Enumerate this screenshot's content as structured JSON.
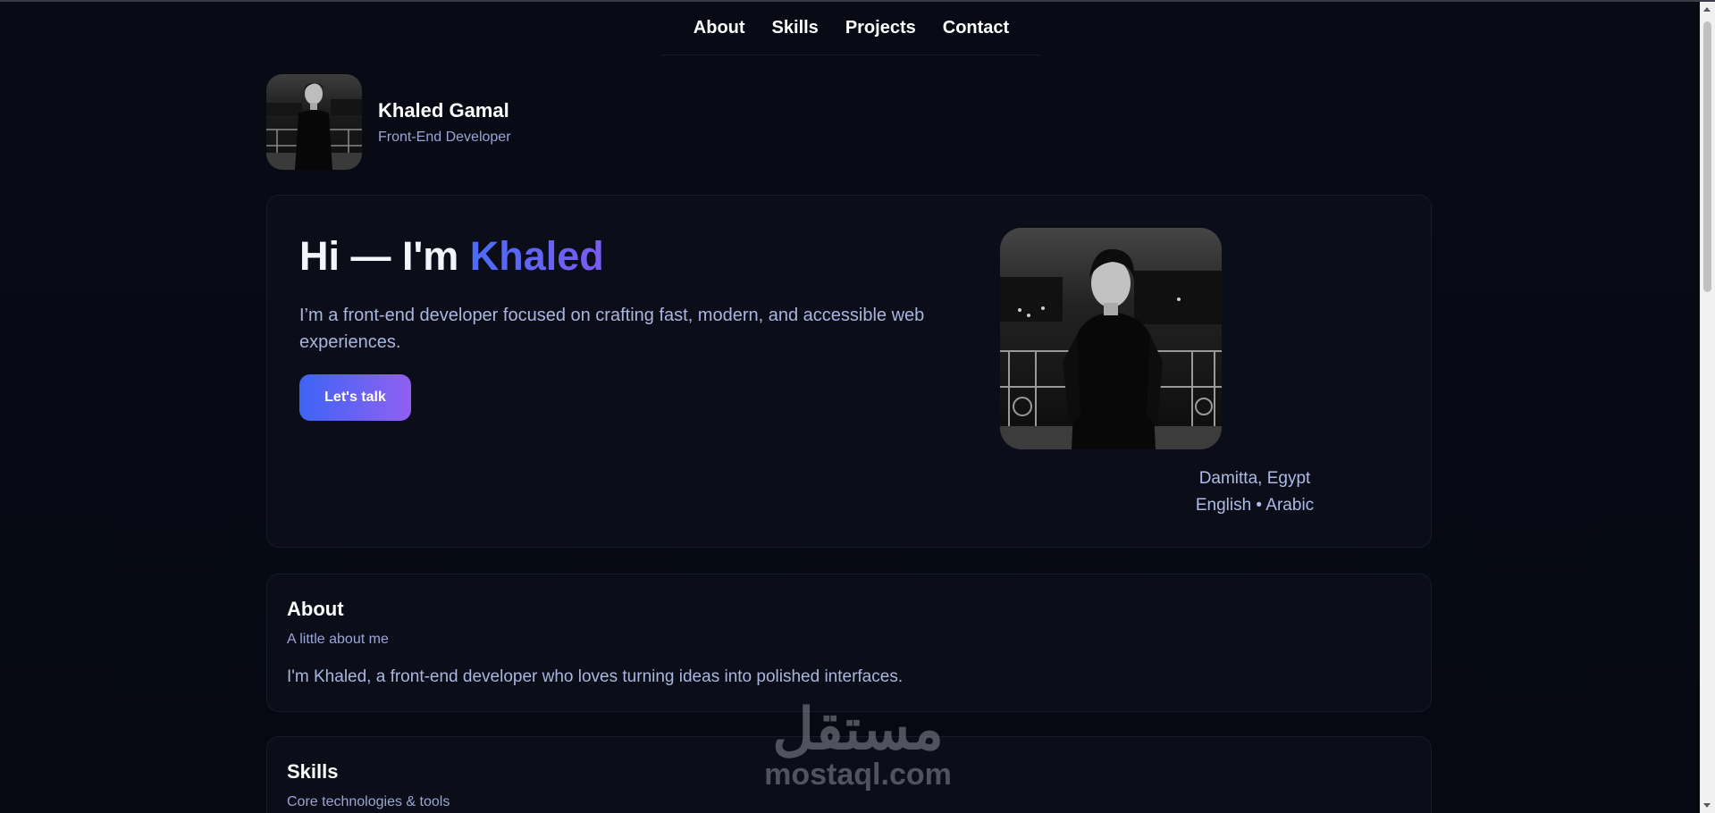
{
  "nav": {
    "items": [
      {
        "label": "About"
      },
      {
        "label": "Skills"
      },
      {
        "label": "Projects"
      },
      {
        "label": "Contact"
      }
    ]
  },
  "profile": {
    "name": "Khaled Gamal",
    "role": "Front-End Developer",
    "avatar_icon": "profile-photo"
  },
  "hero": {
    "greeting": "Hi — I'm ",
    "name_highlight": "Khaled",
    "intro": "I’m a front-end developer focused on crafting fast, modern, and accessible web experiences.",
    "cta_label": "Let's talk",
    "location": "Damitta, Egypt",
    "languages": "English • Arabic"
  },
  "about": {
    "title": "About",
    "subtitle": "A little about me",
    "body": "I'm Khaled, a front-end developer who loves turning ideas into polished interfaces."
  },
  "skills": {
    "title": "Skills",
    "subtitle": "Core technologies & tools"
  },
  "watermark": {
    "arabic": "مستقل",
    "latin": "mostaql.com"
  },
  "colors": {
    "background": "#070a14",
    "card": "#0b0e19",
    "accent_start": "#3d64f5",
    "accent_end": "#9160f0",
    "muted_text": "#9aa6d6"
  }
}
